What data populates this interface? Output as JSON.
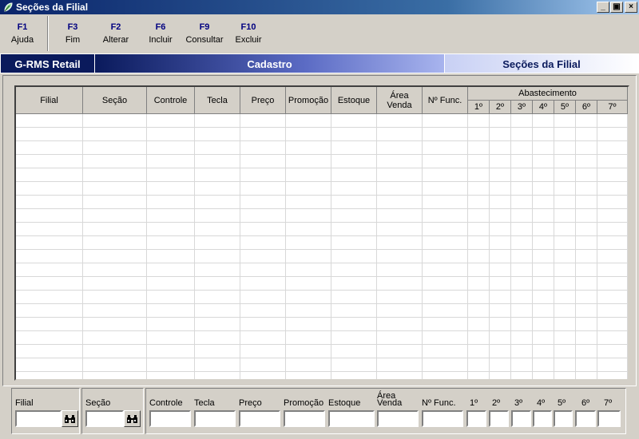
{
  "window": {
    "title": "Seções da Filial",
    "buttons": {
      "minimize": "_",
      "restore": "▣",
      "close": "×"
    }
  },
  "toolbar": {
    "keys": [
      {
        "key": "F1",
        "label": "Ajuda"
      },
      {
        "key": "F3",
        "label": "Fim"
      },
      {
        "key": "F2",
        "label": "Alterar"
      },
      {
        "key": "F6",
        "label": "Incluir"
      },
      {
        "key": "F9",
        "label": "Consultar"
      },
      {
        "key": "F10",
        "label": "Excluir"
      }
    ]
  },
  "banner": {
    "brand": "G-RMS Retail",
    "section": "Cadastro",
    "screen": "Seções da Filial"
  },
  "grid": {
    "columns": [
      "Filial",
      "Seção",
      "Controle",
      "Tecla",
      "Preço",
      "Promoção",
      "Estoque",
      "Área Venda",
      "Nº Func."
    ],
    "area_venda_line1": "Área",
    "area_venda_line2": "Venda",
    "group_label": "Abastecimento",
    "day_columns": [
      "1º",
      "2º",
      "3º",
      "4º",
      "5º",
      "6º",
      "7º"
    ],
    "rows": []
  },
  "filters": {
    "filial_label": "Filial",
    "filial_value": "",
    "secao_label": "Seção",
    "secao_value": "",
    "detail_labels": [
      "Controle",
      "Tecla",
      "Preço",
      "Promoção",
      "Estoque",
      "Área Venda",
      "Nº Func.",
      "1º",
      "2º",
      "3º",
      "4º",
      "5º",
      "6º",
      "7º"
    ],
    "area_line1": "Área",
    "area_line2": "Venda"
  },
  "icons": {
    "app": "leaf-icon",
    "search": "binoculars-icon"
  },
  "colors": {
    "brand_dark": "#0a1a5c",
    "key_color": "#000080",
    "window_bg": "#d4d0c8"
  }
}
